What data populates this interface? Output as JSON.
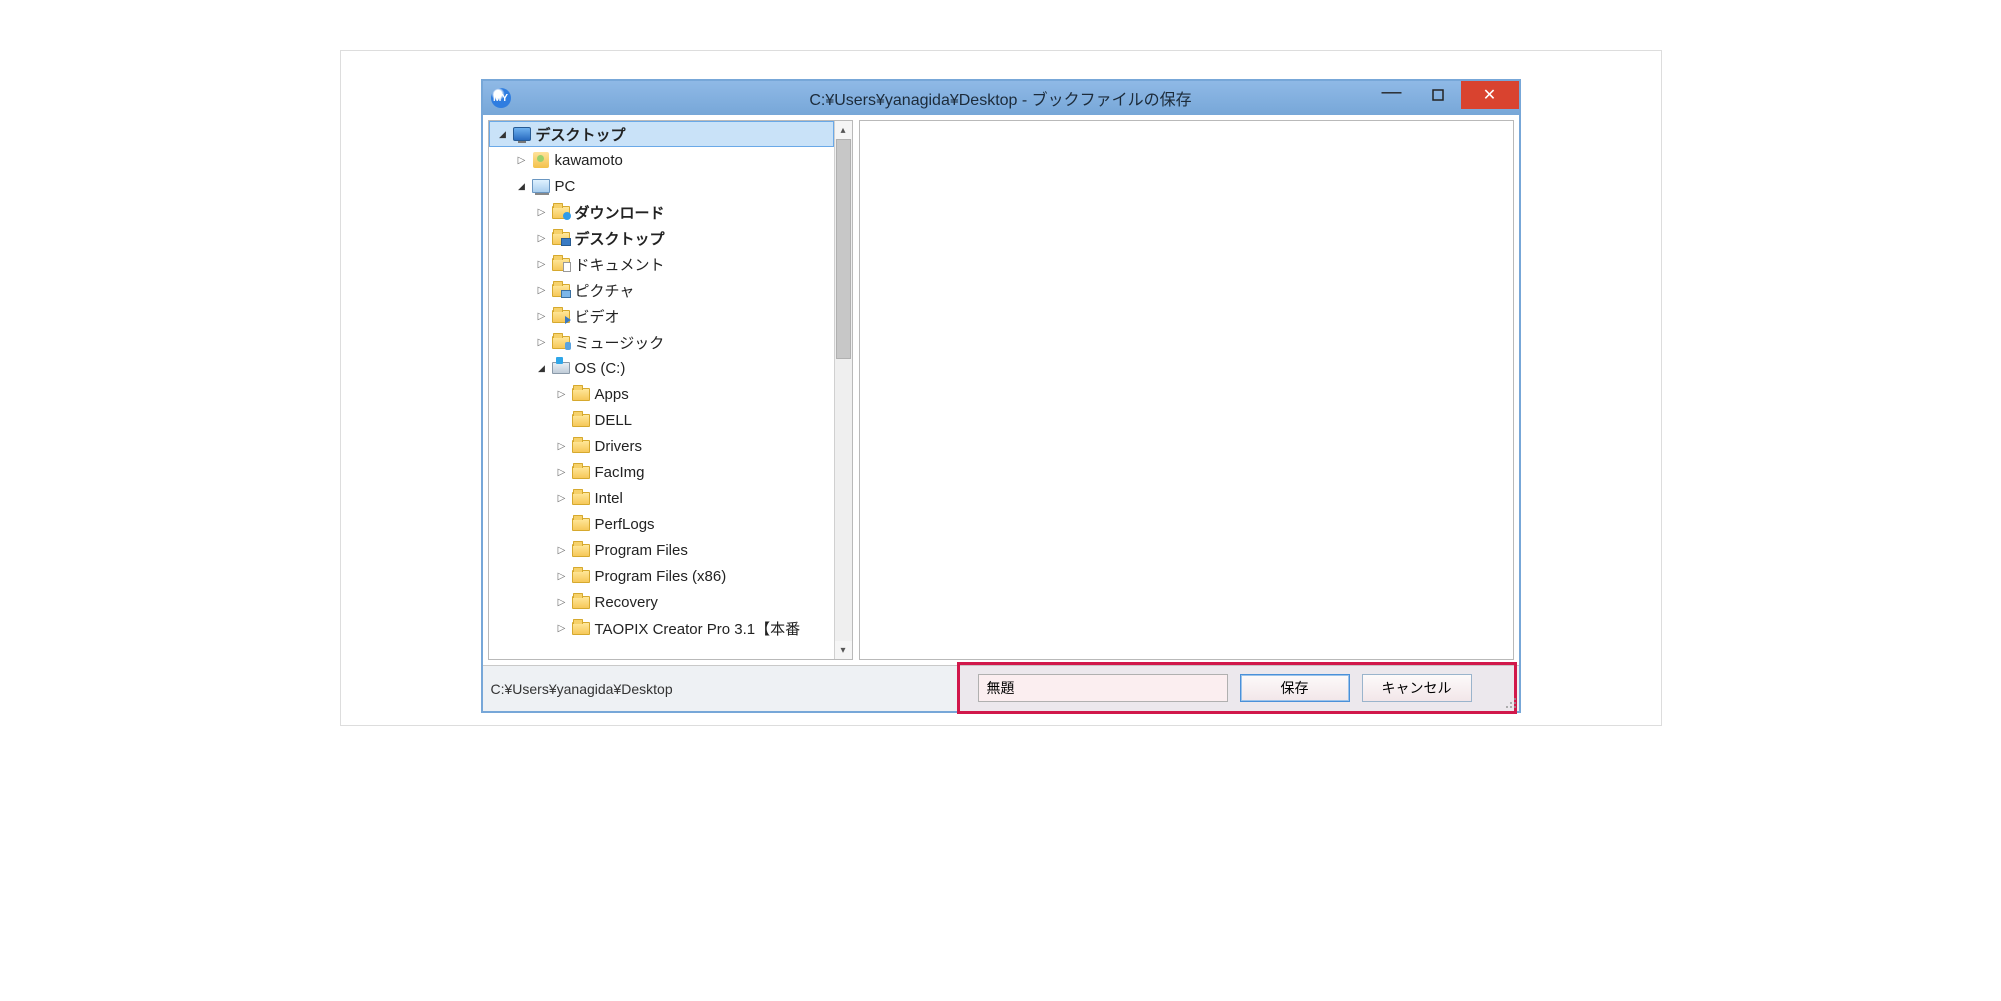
{
  "titlebar": {
    "title": "C:¥Users¥yanagida¥Desktop - ブックファイルの保存",
    "app_badge": "MY"
  },
  "tree": [
    {
      "indent": 0,
      "expander": "down",
      "icon": "monitor",
      "label": "デスクトップ",
      "bold": true,
      "selected": true
    },
    {
      "indent": 1,
      "expander": "right",
      "icon": "user",
      "label": "kawamoto",
      "bold": false
    },
    {
      "indent": 1,
      "expander": "down",
      "icon": "pc",
      "label": "PC",
      "bold": false
    },
    {
      "indent": 2,
      "expander": "right",
      "icon": "folder-dl",
      "label": "ダウンロード",
      "bold": true
    },
    {
      "indent": 2,
      "expander": "right",
      "icon": "folder-dsk",
      "label": "デスクトップ",
      "bold": true
    },
    {
      "indent": 2,
      "expander": "right",
      "icon": "folder-doc",
      "label": "ドキュメント",
      "bold": false
    },
    {
      "indent": 2,
      "expander": "right",
      "icon": "folder-pic",
      "label": "ピクチャ",
      "bold": false
    },
    {
      "indent": 2,
      "expander": "right",
      "icon": "folder-vid",
      "label": "ビデオ",
      "bold": false
    },
    {
      "indent": 2,
      "expander": "right",
      "icon": "folder-mus",
      "label": "ミュージック",
      "bold": false
    },
    {
      "indent": 2,
      "expander": "down",
      "icon": "drive",
      "label": "OS (C:)",
      "bold": false
    },
    {
      "indent": 3,
      "expander": "right",
      "icon": "folder",
      "label": "Apps",
      "bold": false
    },
    {
      "indent": 3,
      "expander": "none",
      "icon": "folder",
      "label": "DELL",
      "bold": false
    },
    {
      "indent": 3,
      "expander": "right",
      "icon": "folder",
      "label": "Drivers",
      "bold": false
    },
    {
      "indent": 3,
      "expander": "right",
      "icon": "folder",
      "label": "FacImg",
      "bold": false
    },
    {
      "indent": 3,
      "expander": "right",
      "icon": "folder",
      "label": "Intel",
      "bold": false
    },
    {
      "indent": 3,
      "expander": "none",
      "icon": "folder",
      "label": "PerfLogs",
      "bold": false
    },
    {
      "indent": 3,
      "expander": "right",
      "icon": "folder",
      "label": "Program Files",
      "bold": false
    },
    {
      "indent": 3,
      "expander": "right",
      "icon": "folder",
      "label": "Program Files (x86)",
      "bold": false
    },
    {
      "indent": 3,
      "expander": "right",
      "icon": "folder",
      "label": "Recovery",
      "bold": false
    },
    {
      "indent": 3,
      "expander": "right",
      "icon": "folder",
      "label": "TAOPIX Creator Pro 3.1【本番",
      "bold": false
    }
  ],
  "statusbar": {
    "path": "C:¥Users¥yanagida¥Desktop"
  },
  "dialog": {
    "filename_value": "無題",
    "save_label": "保存",
    "cancel_label": "キャンセル"
  }
}
